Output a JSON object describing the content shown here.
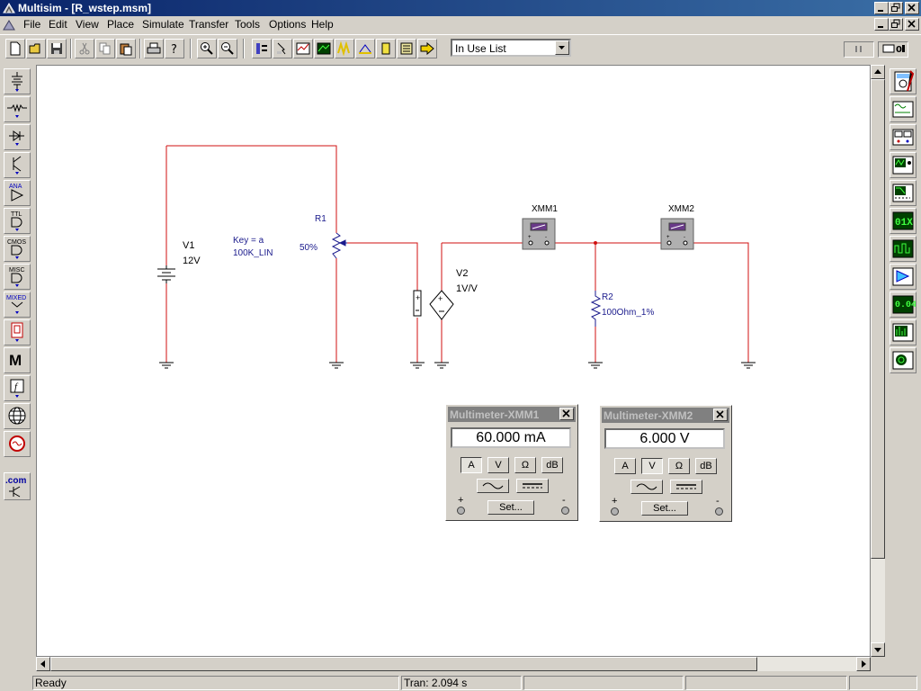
{
  "window": {
    "title": "Multisim - [R_wstep.msm]"
  },
  "menu": {
    "items": [
      {
        "label": "File"
      },
      {
        "label": "Edit"
      },
      {
        "label": "View"
      },
      {
        "label": "Place"
      },
      {
        "label": "Simulate"
      },
      {
        "label": "Transfer"
      },
      {
        "label": "Tools"
      },
      {
        "label": "Options"
      },
      {
        "label": "Help"
      }
    ]
  },
  "toolbar": {
    "in_use_list": "In Use List"
  },
  "component_toolbar": {
    "items": [
      {
        "icon": "sources-icon"
      },
      {
        "icon": "basic-icon"
      },
      {
        "icon": "diodes-icon"
      },
      {
        "icon": "transistors-icon",
        "label": ""
      },
      {
        "icon": "analog-icon",
        "label": "ANA"
      },
      {
        "icon": "ttl-icon",
        "label": "TTL"
      },
      {
        "icon": "cmos-icon",
        "label": "CMOS"
      },
      {
        "icon": "misc-digital-icon",
        "label": "MISC"
      },
      {
        "icon": "mixed-icon",
        "label": "MIXED"
      },
      {
        "icon": "indicators-icon"
      },
      {
        "icon": "misc-icon",
        "label": "M"
      },
      {
        "icon": "controls-icon",
        "label": "f"
      },
      {
        "icon": "rf-icon"
      },
      {
        "icon": "electromechanical-icon"
      },
      {
        "icon": "com-icon",
        "label": ".com"
      }
    ]
  },
  "schematic": {
    "v1": {
      "ref": "V1",
      "value": "12V"
    },
    "r1": {
      "ref": "R1",
      "key": "Key = a",
      "model": "100K_LIN",
      "percent": "50%"
    },
    "v2": {
      "ref": "V2",
      "value": "1V/V"
    },
    "xmm1": {
      "ref": "XMM1"
    },
    "xmm2": {
      "ref": "XMM2"
    },
    "r2": {
      "ref": "R2",
      "value": "100Ohm_1%"
    }
  },
  "multimeter1": {
    "title": "Multimeter-XMM1",
    "reading": "60.000 mA",
    "buttons": {
      "a": "A",
      "v": "V",
      "ohm": "Ω",
      "db": "dB"
    },
    "active_mode": "A",
    "set_label": "Set...",
    "plus": "+",
    "minus": "-"
  },
  "multimeter2": {
    "title": "Multimeter-XMM2",
    "reading": "6.000  V",
    "buttons": {
      "a": "A",
      "v": "V",
      "ohm": "Ω",
      "db": "dB"
    },
    "active_mode": "V",
    "set_label": "Set...",
    "plus": "+",
    "minus": "-"
  },
  "statusbar": {
    "status": "Ready",
    "sim_time": "Tran: 2.094 s"
  },
  "colors": {
    "wire": "#d01010",
    "component": "#1a1a8c",
    "title_active": "#0a246a",
    "title_inactive": "#808080"
  }
}
